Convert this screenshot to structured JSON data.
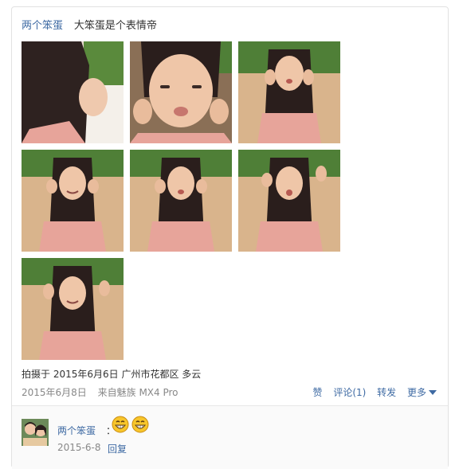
{
  "post": {
    "author": "两个笨蛋",
    "text": "大笨蛋是个表情帝",
    "photo_count": 7,
    "location_line": "拍摄于 2015年6月6日 广州市花都区 多云",
    "date": "2015年6月8日",
    "source": "来自魅族 MX4 Pro",
    "actions": {
      "like": "赞",
      "comment": "评论(1)",
      "share": "转发",
      "more": "更多"
    }
  },
  "comment": {
    "author": "两个笨蛋",
    "colon": "：",
    "emojis": [
      "grin-emoji",
      "grin-emoji"
    ],
    "date": "2015-6-8",
    "reply": "回复"
  },
  "colors": {
    "link": "#3e6aa3",
    "meta": "#888888",
    "border": "#e2e2e2"
  }
}
